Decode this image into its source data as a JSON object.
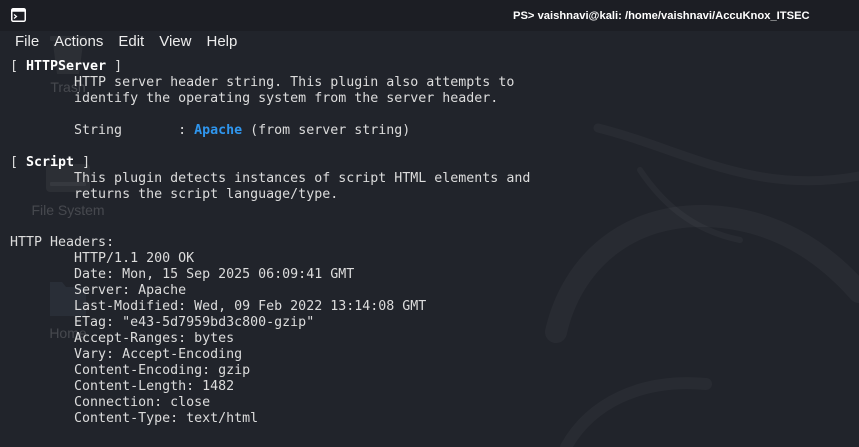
{
  "window": {
    "icon": "terminal-icon",
    "title": "PS> vaishnavi@kali: /home/vaishnavi/AccuKnox_ITSEC"
  },
  "menu": {
    "items": [
      {
        "label": "File"
      },
      {
        "label": "Actions"
      },
      {
        "label": "Edit"
      },
      {
        "label": "View"
      },
      {
        "label": "Help"
      }
    ]
  },
  "desktop": {
    "icons": [
      {
        "label": "Trash",
        "icon": "trash-icon"
      },
      {
        "label": "File System",
        "icon": "drive-icon"
      },
      {
        "label": "Home",
        "icon": "folder-icon"
      }
    ]
  },
  "terminal": {
    "plugins": [
      {
        "open": "[",
        "name": "HTTPServer",
        "close": "]",
        "description": [
          "HTTP server header string. This plugin also attempts to",
          "identify the operating system from the server header."
        ],
        "field": {
          "label": "String",
          "separator": ":",
          "value": "Apache",
          "note": "(from server string)"
        }
      },
      {
        "open": "[",
        "name": "Script",
        "close": "]",
        "description": [
          "This plugin detects instances of script HTML elements and",
          "returns the script language/type."
        ]
      }
    ],
    "headers_title": "HTTP Headers:",
    "headers": [
      "HTTP/1.1 200 OK",
      "Date: Mon, 15 Sep 2025 06:09:41 GMT",
      "Server: Apache",
      "Last-Modified: Wed, 09 Feb 2022 13:14:08 GMT",
      "ETag: \"e43-5d7959bd3c800-gzip\"",
      "Accept-Ranges: bytes",
      "Vary: Accept-Encoding",
      "Content-Encoding: gzip",
      "Content-Length: 1482",
      "Connection: close",
      "Content-Type: text/html"
    ]
  },
  "colors": {
    "window_background": "#21242b",
    "titlebar_background": "#1c1e24",
    "text": "#dcdcdc",
    "heading": "#ffffff",
    "highlight": "#2f96ee"
  }
}
